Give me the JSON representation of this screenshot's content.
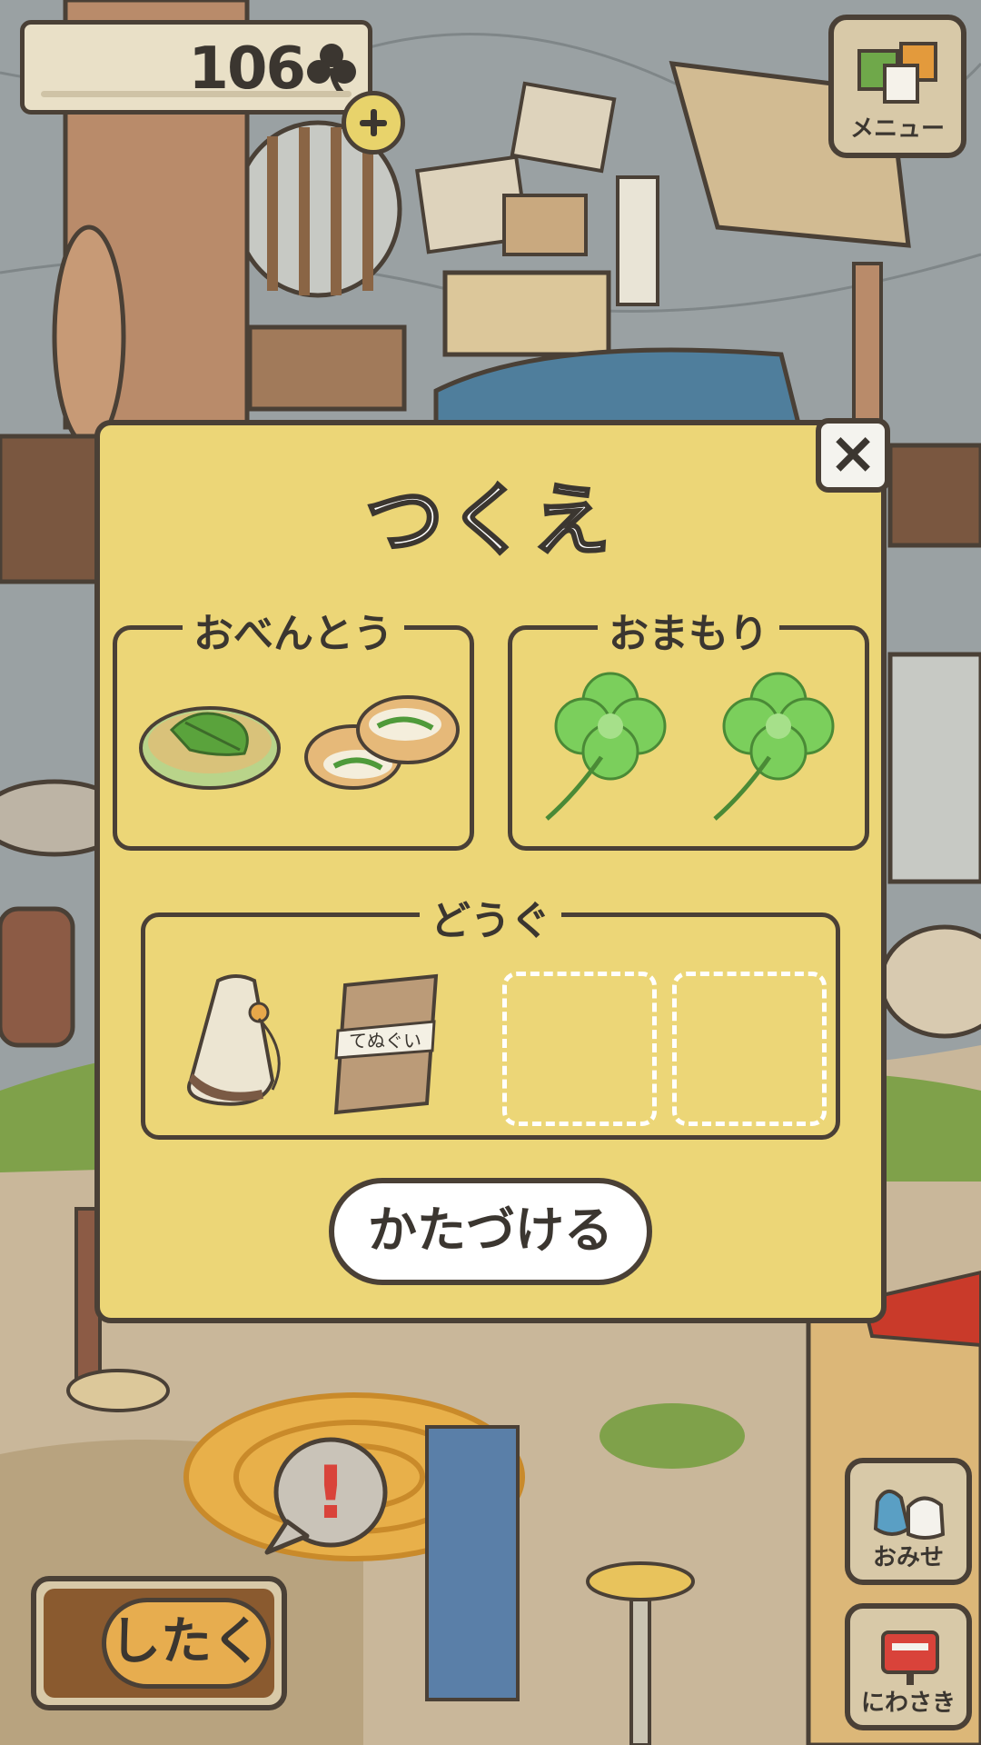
{
  "header": {
    "clover_count": "106",
    "add_clover_label": "+",
    "menu_label": "メニュー"
  },
  "dialog": {
    "title": "つくえ",
    "close_label": "×",
    "sections": {
      "lunch": {
        "label": "おべんとう",
        "items": [
          "green-pancake",
          "bread-sandwich"
        ]
      },
      "charm": {
        "label": "おまもり",
        "items": [
          "four-leaf-clover",
          "four-leaf-clover"
        ]
      },
      "tools": {
        "label": "どうぐ",
        "items": [
          "drawstring-bottle",
          "tenugui-towel"
        ],
        "wrap_text": "てぬぐい",
        "empty_slots": 2
      }
    },
    "tidy_button_label": "かたづける"
  },
  "bottom": {
    "prepare_label": "したく",
    "shop_label": "おみせ",
    "garden_label": "にわさき",
    "alert_symbol": "!"
  },
  "colors": {
    "dialog_bg": "#ecd677",
    "outline": "#4a4036",
    "scene_wall": "#9aa1a3",
    "grass": "#7fa14a"
  }
}
